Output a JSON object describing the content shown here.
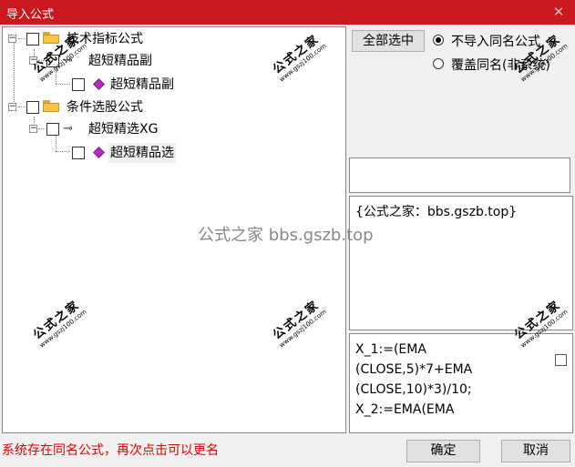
{
  "window": {
    "title": "导入公式",
    "close_glyph": "✕"
  },
  "tree": {
    "nodes": [
      {
        "label": "技术指标公式"
      },
      {
        "label": "超短精品副"
      },
      {
        "label": "超短精品副"
      },
      {
        "label": "条件选股公式"
      },
      {
        "label": "超短精选XG"
      },
      {
        "label": "超短精品选"
      }
    ],
    "expanded_glyph": "−"
  },
  "options": {
    "select_all_button": "全部选中",
    "radio_skip": "不导入同名公式",
    "radio_overwrite": "覆盖同名(非系统)",
    "selected": "skip"
  },
  "description": "{公式之家：bbs.gszb.top}",
  "formula_text": "X_1:=(EMA\n(CLOSE,5)*7+EMA\n(CLOSE,10)*3)/10;\nX_2:=EMA(EMA",
  "status_message": "系统存在同名公式，再次点击可以更名",
  "buttons": {
    "ok": "确定",
    "cancel": "取消"
  },
  "watermark": {
    "line1": "公式之家",
    "line2": "www.gszj100.com",
    "center": "公式之家 bbs.gszb.top"
  },
  "colors": {
    "titlebar": "#c9191e",
    "status_text": "#e00000",
    "gem": "#b82cc0",
    "folder": "#f5c542"
  }
}
